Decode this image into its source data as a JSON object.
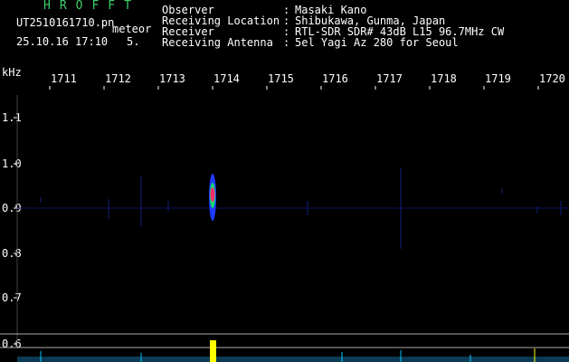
{
  "header": {
    "title": "HROFFT",
    "filename": "UT2510161710.pn",
    "mode": "meteor",
    "date": "25.10.16 17:10",
    "second": "5.",
    "colon": ":",
    "rows": [
      {
        "label": "Observer",
        "value": "Masaki Kano"
      },
      {
        "label": "Receiving Location",
        "value": "Shibukawa, Gunma, Japan"
      },
      {
        "label": "Receiver",
        "value": "RTL-SDR SDR# 43dB L15 96.7MHz CW"
      },
      {
        "label": "Receiving Antenna",
        "value": "5el Yagi Az 280 for Seoul"
      }
    ]
  },
  "y_axis": {
    "unit": "kHz",
    "ticks": [
      "1.1",
      "1.0",
      "0.9",
      "0.8",
      "0.7",
      "0.6"
    ]
  },
  "x_axis": {
    "ticks": [
      "1711",
      "1712",
      "1713",
      "1714",
      "1715",
      "1716",
      "1717",
      "1718",
      "1719",
      "1720"
    ]
  },
  "colors": {
    "background": "#000000",
    "header_green": "#3fd06a",
    "echo_core": "#ff2a6a",
    "echo_mid": "#18e06a",
    "echo_outer": "#1f3cff",
    "bottom_signal": "#ffff00",
    "bottom_trace": "#00c8ff"
  }
}
